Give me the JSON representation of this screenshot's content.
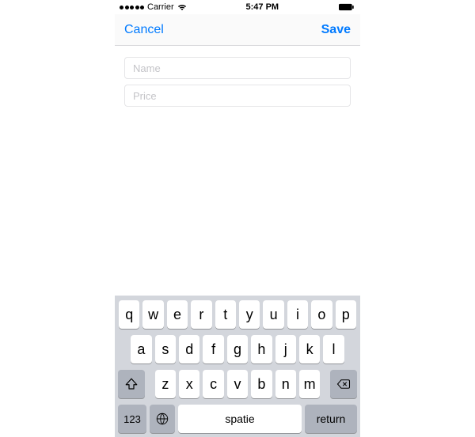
{
  "status": {
    "carrier": "Carrier",
    "time": "5:47 PM"
  },
  "nav": {
    "cancel_label": "Cancel",
    "save_label": "Save"
  },
  "form": {
    "name_value": "",
    "name_placeholder": "Name",
    "price_value": "",
    "price_placeholder": "Price"
  },
  "keyboard": {
    "row1": [
      "q",
      "w",
      "e",
      "r",
      "t",
      "y",
      "u",
      "i",
      "o",
      "p"
    ],
    "row2": [
      "a",
      "s",
      "d",
      "f",
      "g",
      "h",
      "j",
      "k",
      "l"
    ],
    "row3": [
      "z",
      "x",
      "c",
      "v",
      "b",
      "n",
      "m"
    ],
    "numbers_key": "123",
    "space_key": "spatie",
    "return_key": "return"
  }
}
